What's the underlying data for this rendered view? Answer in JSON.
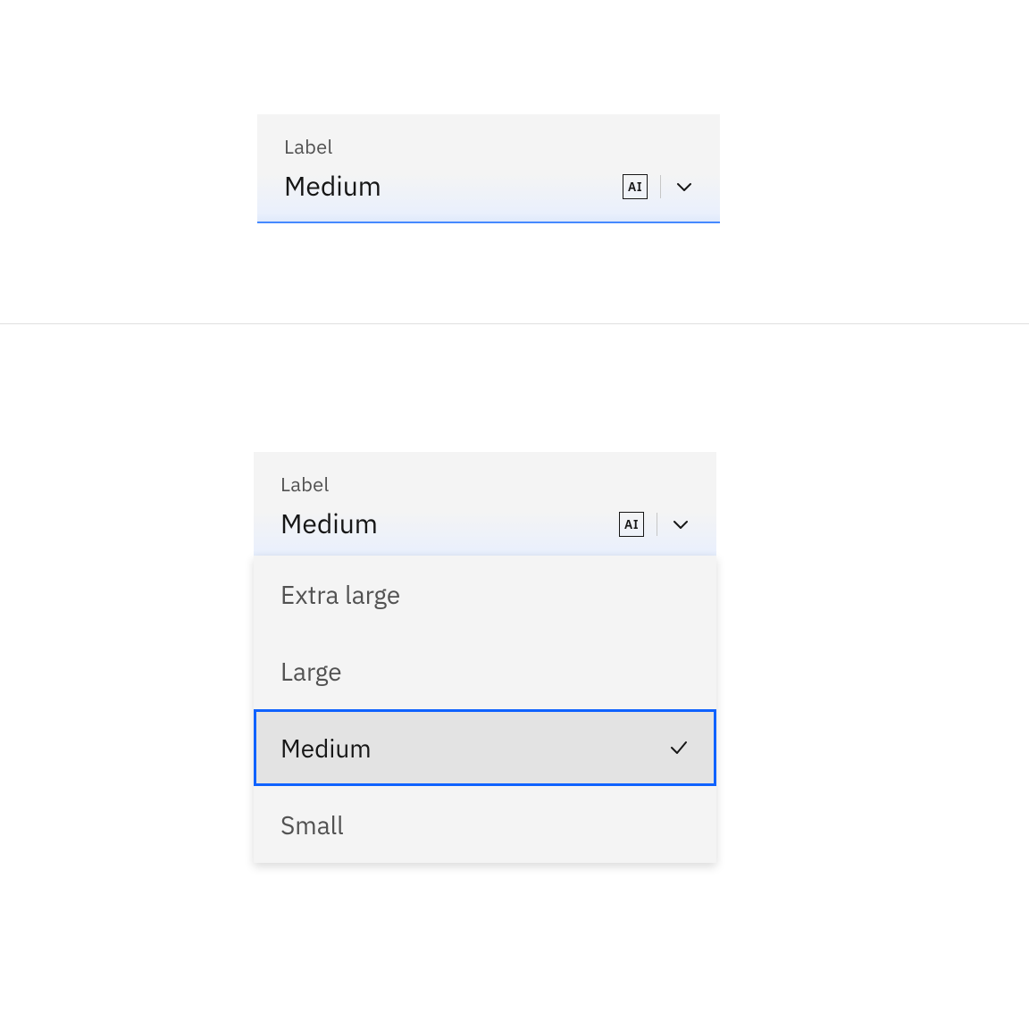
{
  "closed_dropdown": {
    "label": "Label",
    "value": "Medium",
    "ai_badge_text": "AI"
  },
  "open_dropdown": {
    "label": "Label",
    "value": "Medium",
    "ai_badge_text": "AI",
    "options": {
      "0": {
        "label": "Extra large"
      },
      "1": {
        "label": "Large"
      },
      "2": {
        "label": "Medium"
      },
      "3": {
        "label": "Small"
      }
    },
    "selected_index": 2
  }
}
